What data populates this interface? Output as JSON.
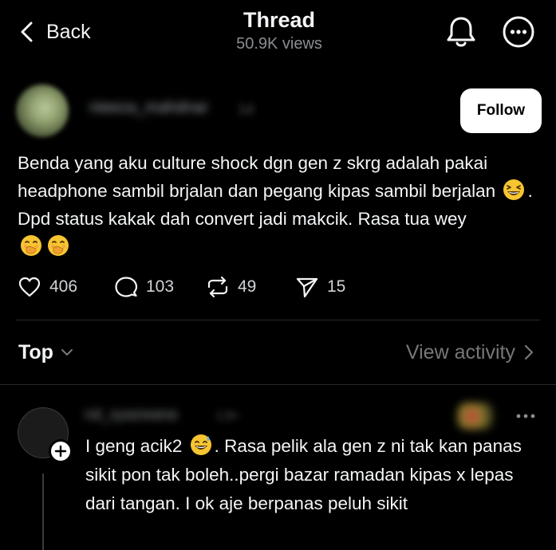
{
  "header": {
    "back_label": "Back",
    "title": "Thread",
    "views": "50.9K views",
    "icons": [
      "chevron-left-icon",
      "bell-icon",
      "more-icon"
    ]
  },
  "post": {
    "author_name": "nieeza_mahdnar",
    "time": "1d",
    "follow_label": "Follow",
    "text_1": "Benda yang aku culture shock dgn gen z skrg adalah pakai headphone sambil brjalan dan pegang kipas sambil berjalan",
    "text_2": ". Dpd status kakak dah convert jadi makcik. Rasa tua wey",
    "emojis": [
      "grinning-squinting-face",
      "face-with-hand-over-mouth",
      "face-with-hand-over-mouth"
    ],
    "likes": "406",
    "comments": "103",
    "reposts": "49",
    "shares": "15"
  },
  "sort": {
    "label": "Top",
    "view_activity": "View activity"
  },
  "reply": {
    "author_name": "nd_syazwana",
    "time": "13h",
    "text_1": "I geng acik2",
    "text_2": ". Rasa pelik ala gen z ni tak kan panas sikit pon tak boleh..pergi bazar ramadan kipas x lepas dari tangan. I ok aje berpanas peluh sikit",
    "emojis": [
      "grinning-face-with-sweat"
    ]
  },
  "colors": {
    "background": "#000000",
    "text": "#f3f5f7",
    "muted": "#777777",
    "divider": "#2a2a2a"
  }
}
